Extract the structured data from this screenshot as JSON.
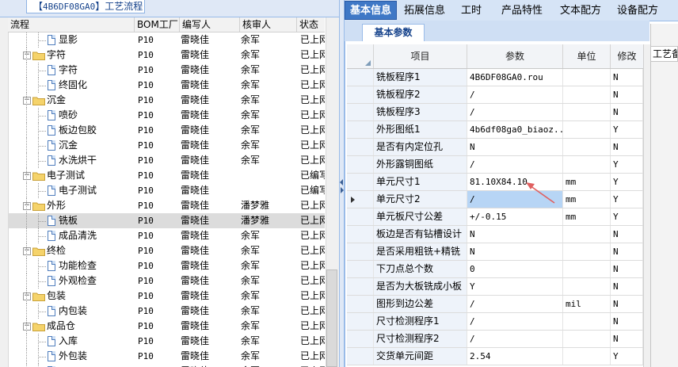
{
  "left_tab": {
    "code": "4B6DF08GA0",
    "title": "工艺流程"
  },
  "tree": {
    "columns": [
      "流程",
      "BOM工厂",
      "编写人",
      "核审人",
      "状态"
    ],
    "rows": [
      {
        "label": "显影",
        "type": "doc",
        "level": 2,
        "bom": "P10",
        "author": "雷晓佳",
        "reviewer": "余军",
        "status": "已上网"
      },
      {
        "label": "字符",
        "type": "folder",
        "level": 1,
        "bom": "P10",
        "author": "雷晓佳",
        "reviewer": "余军",
        "status": "已上网"
      },
      {
        "label": "字符",
        "type": "doc",
        "level": 2,
        "bom": "P10",
        "author": "雷晓佳",
        "reviewer": "余军",
        "status": "已上网"
      },
      {
        "label": "终固化",
        "type": "doc",
        "level": 2,
        "bom": "P10",
        "author": "雷晓佳",
        "reviewer": "余军",
        "status": "已上网"
      },
      {
        "label": "沉金",
        "type": "folder",
        "level": 1,
        "bom": "P10",
        "author": "雷晓佳",
        "reviewer": "余军",
        "status": "已上网"
      },
      {
        "label": "喷砂",
        "type": "doc",
        "level": 2,
        "bom": "P10",
        "author": "雷晓佳",
        "reviewer": "余军",
        "status": "已上网"
      },
      {
        "label": "板边包胶",
        "type": "doc",
        "level": 2,
        "bom": "P10",
        "author": "雷晓佳",
        "reviewer": "余军",
        "status": "已上网"
      },
      {
        "label": "沉金",
        "type": "doc",
        "level": 2,
        "bom": "P10",
        "author": "雷晓佳",
        "reviewer": "余军",
        "status": "已上网"
      },
      {
        "label": "水洗烘干",
        "type": "doc",
        "level": 2,
        "bom": "P10",
        "author": "雷晓佳",
        "reviewer": "余军",
        "status": "已上网"
      },
      {
        "label": "电子测试",
        "type": "folder",
        "level": 1,
        "bom": "P10",
        "author": "雷晓佳",
        "reviewer": "",
        "status": "已编写"
      },
      {
        "label": "电子测试",
        "type": "doc",
        "level": 2,
        "bom": "P10",
        "author": "雷晓佳",
        "reviewer": "",
        "status": "已编写"
      },
      {
        "label": "外形",
        "type": "folder",
        "level": 1,
        "bom": "P10",
        "author": "雷晓佳",
        "reviewer": "潘梦雅",
        "status": "已上网"
      },
      {
        "label": "铣板",
        "type": "doc",
        "level": 2,
        "bom": "P10",
        "author": "雷晓佳",
        "reviewer": "潘梦雅",
        "status": "已上网",
        "selected": true
      },
      {
        "label": "成品清洗",
        "type": "doc",
        "level": 2,
        "bom": "P10",
        "author": "雷晓佳",
        "reviewer": "余军",
        "status": "已上网"
      },
      {
        "label": "终检",
        "type": "folder",
        "level": 1,
        "bom": "P10",
        "author": "雷晓佳",
        "reviewer": "余军",
        "status": "已上网"
      },
      {
        "label": "功能检查",
        "type": "doc",
        "level": 2,
        "bom": "P10",
        "author": "雷晓佳",
        "reviewer": "余军",
        "status": "已上网"
      },
      {
        "label": "外观检查",
        "type": "doc",
        "level": 2,
        "bom": "P10",
        "author": "雷晓佳",
        "reviewer": "余军",
        "status": "已上网"
      },
      {
        "label": "包装",
        "type": "folder",
        "level": 1,
        "bom": "P10",
        "author": "雷晓佳",
        "reviewer": "余军",
        "status": "已上网"
      },
      {
        "label": "内包装",
        "type": "doc",
        "level": 2,
        "bom": "P10",
        "author": "雷晓佳",
        "reviewer": "余军",
        "status": "已上网"
      },
      {
        "label": "成品仓",
        "type": "folder",
        "level": 1,
        "bom": "P10",
        "author": "雷晓佳",
        "reviewer": "余军",
        "status": "已上网"
      },
      {
        "label": "入库",
        "type": "doc",
        "level": 2,
        "bom": "P10",
        "author": "雷晓佳",
        "reviewer": "余军",
        "status": "已上网"
      },
      {
        "label": "外包装",
        "type": "doc",
        "level": 2,
        "bom": "P10",
        "author": "雷晓佳",
        "reviewer": "余军",
        "status": "已上网"
      },
      {
        "label": "",
        "type": "doc",
        "level": 2,
        "bom": "P10",
        "author": "雷晓佳",
        "reviewer": "余军",
        "status": "已上网"
      }
    ]
  },
  "main_tabs": [
    "基本信息",
    "拓展信息",
    "工时",
    "产品特性",
    "文本配方",
    "设备配方"
  ],
  "sub_tab": "基本参数",
  "right_tab": "工艺备",
  "grid": {
    "columns": [
      "项目",
      "参数",
      "单位",
      "修改"
    ],
    "rows": [
      {
        "item": "铣板程序1",
        "param": "4B6DF08GA0.rou",
        "unit": "",
        "mod": "N"
      },
      {
        "item": "铣板程序2",
        "param": "/",
        "unit": "",
        "mod": "N"
      },
      {
        "item": "铣板程序3",
        "param": "/",
        "unit": "",
        "mod": "N"
      },
      {
        "item": "外形图纸1",
        "param": "4b6df08ga0_biaoz...",
        "unit": "",
        "mod": "Y"
      },
      {
        "item": "是否有内定位孔",
        "param": "N",
        "unit": "",
        "mod": "N"
      },
      {
        "item": "外形露铜图纸",
        "param": "/",
        "unit": "",
        "mod": "Y"
      },
      {
        "item": "单元尺寸1",
        "param": "81.10X84.10",
        "unit": "mm",
        "mod": "Y"
      },
      {
        "item": "单元尺寸2",
        "param": "/",
        "unit": "mm",
        "mod": "Y",
        "current": true
      },
      {
        "item": "单元板尺寸公差",
        "param": "+/-0.15",
        "unit": "mm",
        "mod": "Y"
      },
      {
        "item": "板边是否有钻槽设计",
        "param": "N",
        "unit": "",
        "mod": "N"
      },
      {
        "item": "是否采用粗铣+精铣",
        "param": "N",
        "unit": "",
        "mod": "N"
      },
      {
        "item": "下刀点总个数",
        "param": "0",
        "unit": "",
        "mod": "N"
      },
      {
        "item": "是否为大板铣成小板",
        "param": "Y",
        "unit": "",
        "mod": "N"
      },
      {
        "item": "图形到边公差",
        "param": "/",
        "unit": "mil",
        "mod": "N"
      },
      {
        "item": "尺寸检测程序1",
        "param": "/",
        "unit": "",
        "mod": "N"
      },
      {
        "item": "尺寸检测程序2",
        "param": "/",
        "unit": "",
        "mod": "N"
      },
      {
        "item": "交货单元间距",
        "param": "2.54",
        "unit": "",
        "mod": "Y"
      }
    ]
  },
  "colors": {
    "accent": "#3f78c6",
    "annotation_arrow": "#e06060",
    "selected_row": "#dcdcdc",
    "current_cell": "#b7d5f5"
  }
}
